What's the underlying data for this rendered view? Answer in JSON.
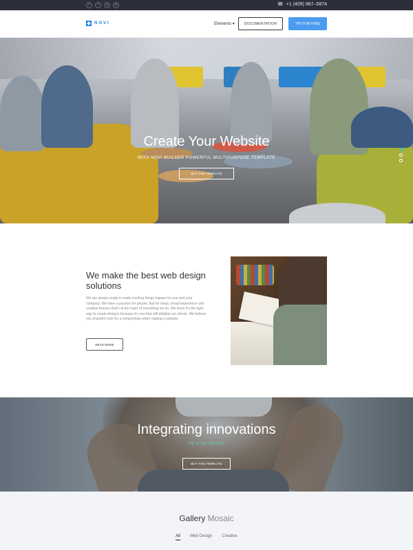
{
  "topbar": {
    "social": [
      "f",
      "t",
      "g",
      "in"
    ],
    "phone": "+1 (409) 987–5874"
  },
  "header": {
    "logo_text": "NOVI",
    "nav_elements": "Elements",
    "documentation": "DOCUMENTATION",
    "try_free": "TRY FOR FREE"
  },
  "hero": {
    "title": "Create Your Website",
    "subtitle": "WITH NOVI BUILDER POWERFUL MULTIPURPOSE TEMPLATE",
    "button": "BUY THIS TEMPLATE",
    "slides": 3,
    "active_slide": 1
  },
  "about": {
    "title": "We make the best web design solutions",
    "text": "We are always ready to make exciting things happen for you and your company. We have a passion for people, flair for ideas, broad experience and creative bravery that's at the heart of everything we do. We know it's the right way to create designs because it's one that still delights our clients. We believe you shouldn't look for a compromise when making a website.",
    "button": "READ MORE"
  },
  "innovations": {
    "title": "Integrating innovations",
    "subtitle": "VR & AR READY",
    "button": "BUY THIS TEMPLATE"
  },
  "gallery": {
    "title_main": "Gallery",
    "title_light": "Mosaic",
    "filters": [
      "All",
      "Web Design",
      "Creative"
    ],
    "active_filter": "All"
  },
  "colors": {
    "accent": "#4b9cf0",
    "teal": "#46c6a8",
    "topbar": "#2b2f3a"
  }
}
